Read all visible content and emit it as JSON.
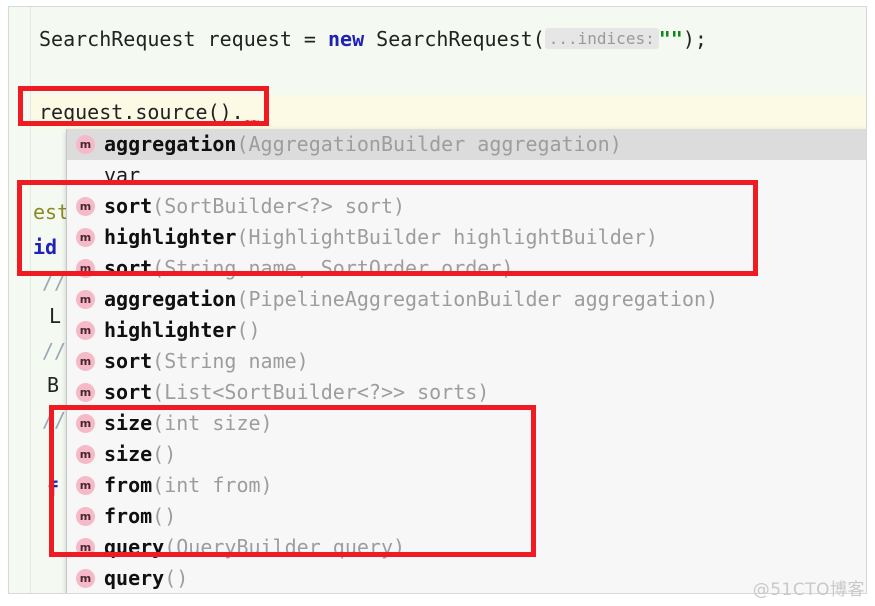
{
  "editor": {
    "line1": {
      "type": "SearchRequest",
      "var_name": " request = ",
      "keyword": "new",
      "ctor": " SearchRequest(",
      "param_hint": "...indices:",
      "string_literal": "\"\"",
      "tail": ");"
    },
    "line2": {
      "text": "request.source()",
      "dot": ".",
      "squiggle": "~~"
    },
    "background_fragments": [
      {
        "text": "est",
        "color_class": "frag-y"
      },
      {
        "text": "id",
        "color_class": "frag-b"
      },
      {
        "text": "//",
        "color_class": "frag-g"
      },
      {
        "text": "L",
        "color_class": "frag-d"
      },
      {
        "text": "//",
        "color_class": "frag-g"
      },
      {
        "text": "B",
        "color_class": "frag-d"
      },
      {
        "text": "//",
        "color_class": "frag-g"
      },
      {
        "text": "f",
        "color_class": "frag-b"
      }
    ]
  },
  "completion_popup": {
    "icon_letter": "m",
    "items": [
      {
        "icon": "method-icon",
        "name": "aggregation",
        "signature": "(AggregationBuilder aggregation)",
        "selected": true,
        "has_icon": true
      },
      {
        "icon": "none",
        "name": "",
        "plain": "var",
        "selected": false,
        "has_icon": false
      },
      {
        "icon": "method-icon",
        "name": "sort",
        "signature": "(SortBuilder<?> sort)",
        "selected": false,
        "has_icon": true
      },
      {
        "icon": "method-icon",
        "name": "highlighter",
        "signature": "(HighlightBuilder highlightBuilder)",
        "selected": false,
        "has_icon": true
      },
      {
        "icon": "method-icon",
        "name": "sort",
        "signature": "(String name, SortOrder order)",
        "selected": false,
        "has_icon": true
      },
      {
        "icon": "method-icon",
        "name": "aggregation",
        "signature": "(PipelineAggregationBuilder aggregation)",
        "selected": false,
        "has_icon": true
      },
      {
        "icon": "method-icon",
        "name": "highlighter",
        "signature": "()",
        "selected": false,
        "has_icon": true
      },
      {
        "icon": "method-icon",
        "name": "sort",
        "signature": "(String name)",
        "selected": false,
        "has_icon": true
      },
      {
        "icon": "method-icon",
        "name": "sort",
        "signature": "(List<SortBuilder<?>> sorts)",
        "selected": false,
        "has_icon": true
      },
      {
        "icon": "method-icon",
        "name": "size",
        "signature": "(int size)",
        "selected": false,
        "has_icon": true
      },
      {
        "icon": "method-icon",
        "name": "size",
        "signature": "()",
        "selected": false,
        "has_icon": true
      },
      {
        "icon": "method-icon",
        "name": "from",
        "signature": "(int from)",
        "selected": false,
        "has_icon": true
      },
      {
        "icon": "method-icon",
        "name": "from",
        "signature": "()",
        "selected": false,
        "has_icon": true
      },
      {
        "icon": "method-icon",
        "name": "query",
        "signature": "(QueryBuilder query)",
        "selected": false,
        "has_icon": true
      },
      {
        "icon": "method-icon",
        "name": "query",
        "signature": "()",
        "selected": false,
        "has_icon": true
      }
    ]
  },
  "annotations": {
    "box_color": "#ee1c22",
    "boxes": [
      {
        "id": "source-call",
        "label": "request.source()"
      },
      {
        "id": "sort-highlight",
        "label": "sort / highlighter group"
      },
      {
        "id": "size-from-query",
        "label": "size / from / query group"
      }
    ]
  },
  "watermark": {
    "text": "@51CTO博客"
  },
  "colors": {
    "editor_background": "#f4f9f2",
    "caret_line": "#fcfae4",
    "popup_background": "#f7f7f7",
    "popup_selected": "#dcdcdc",
    "method_icon": "#f6b9c8",
    "keyword": "#1f22b4",
    "string": "#0b8a18",
    "signature_text": "#9d9d9d",
    "annotation_red": "#ee1c22"
  }
}
